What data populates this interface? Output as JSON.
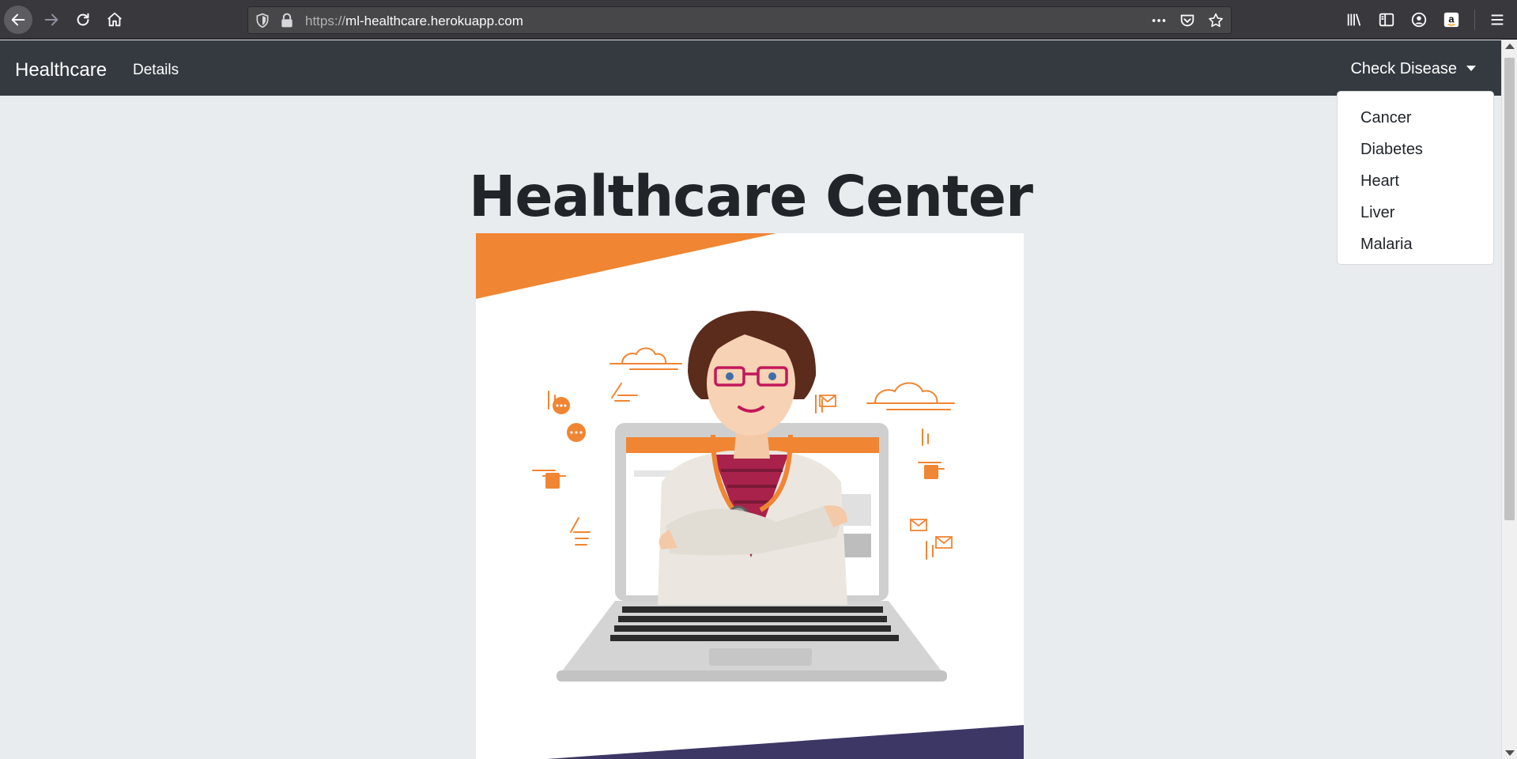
{
  "browser": {
    "url_protocol": "https://",
    "url_host": "ml-healthcare.herokuapp.com",
    "icons": {
      "back": "back-arrow-icon",
      "forward": "forward-arrow-icon",
      "reload": "reload-icon",
      "home": "home-icon",
      "shield": "tracking-shield-icon",
      "lock": "lock-icon",
      "more": "more-actions-icon",
      "pocket": "pocket-icon",
      "bookmark": "bookmark-star-icon",
      "library": "library-icon",
      "sidebar": "sidebar-icon",
      "account": "account-icon",
      "amazon": "amazon-icon",
      "menu": "hamburger-menu-icon"
    }
  },
  "navbar": {
    "brand": "Healthcare",
    "details_link": "Details",
    "dropdown_label": "Check Disease"
  },
  "dropdown": {
    "items": [
      "Cancer",
      "Diabetes",
      "Heart",
      "Liver",
      "Malaria"
    ]
  },
  "main": {
    "title": "Healthcare Center"
  },
  "colors": {
    "navbar_bg": "#343a40",
    "page_bg": "#e9ecef",
    "accent_orange": "#f08533",
    "accent_purple": "#3d3766"
  }
}
